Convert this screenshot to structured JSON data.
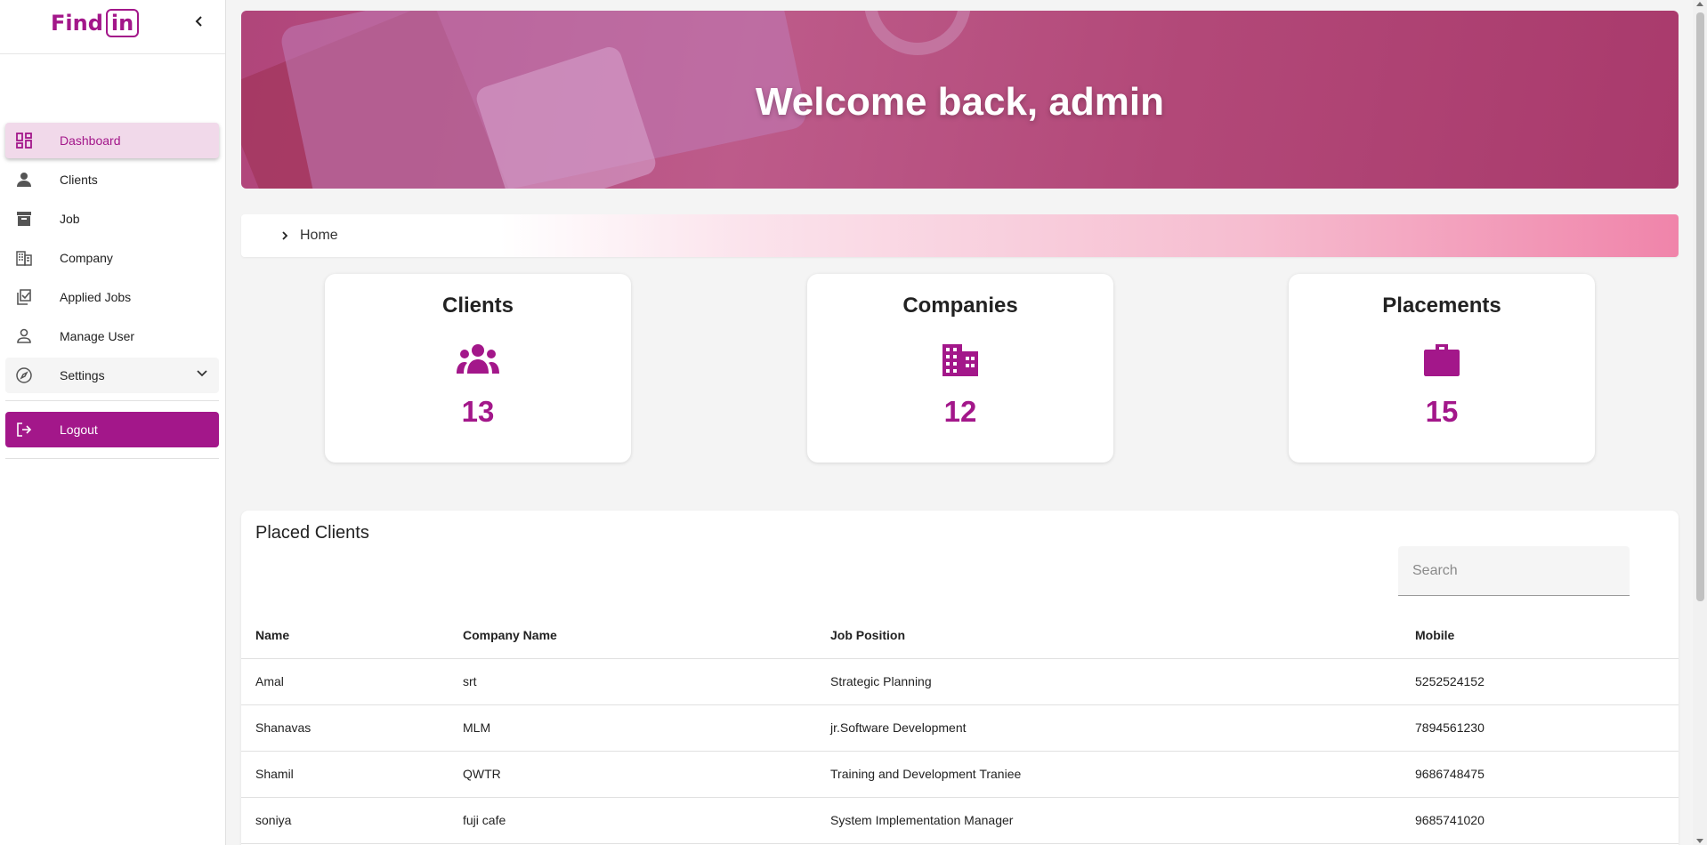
{
  "brand": {
    "logo_left": "F",
    "logo_dot": "i",
    "logo_mid": "nd",
    "logo_box": "in"
  },
  "colors": {
    "accent": "#a3178a",
    "active_bg": "#f1d9ea"
  },
  "sidebar": {
    "items": [
      {
        "label": "Dashboard",
        "icon": "dashboard-icon"
      },
      {
        "label": "Clients",
        "icon": "person-icon"
      },
      {
        "label": "Job",
        "icon": "archive-icon"
      },
      {
        "label": "Company",
        "icon": "building-icon"
      },
      {
        "label": "Applied Jobs",
        "icon": "checklist-icon"
      },
      {
        "label": "Manage User",
        "icon": "user-outline-icon"
      },
      {
        "label": "Settings",
        "icon": "compass-icon"
      }
    ],
    "logout": "Logout"
  },
  "hero": {
    "title": "Welcome back, admin"
  },
  "breadcrumb": {
    "label": "Home"
  },
  "stats": [
    {
      "title": "Clients",
      "value": "13",
      "icon": "group-icon"
    },
    {
      "title": "Companies",
      "value": "12",
      "icon": "building-icon"
    },
    {
      "title": "Placements",
      "value": "15",
      "icon": "briefcase-icon"
    }
  ],
  "placed": {
    "title": "Placed Clients",
    "search_placeholder": "Search",
    "columns": [
      "Name",
      "Company Name",
      "Job Position",
      "Mobile"
    ],
    "rows": [
      [
        "Amal",
        "srt",
        "Strategic Planning",
        "5252524152"
      ],
      [
        "Shanavas",
        "MLM",
        "jr.Software Development",
        "7894561230"
      ],
      [
        "Shamil",
        "QWTR",
        "Training and Development Traniee",
        "9686748475"
      ],
      [
        "soniya",
        "fuji cafe",
        "System Implementation Manager",
        "9685741020"
      ]
    ]
  }
}
